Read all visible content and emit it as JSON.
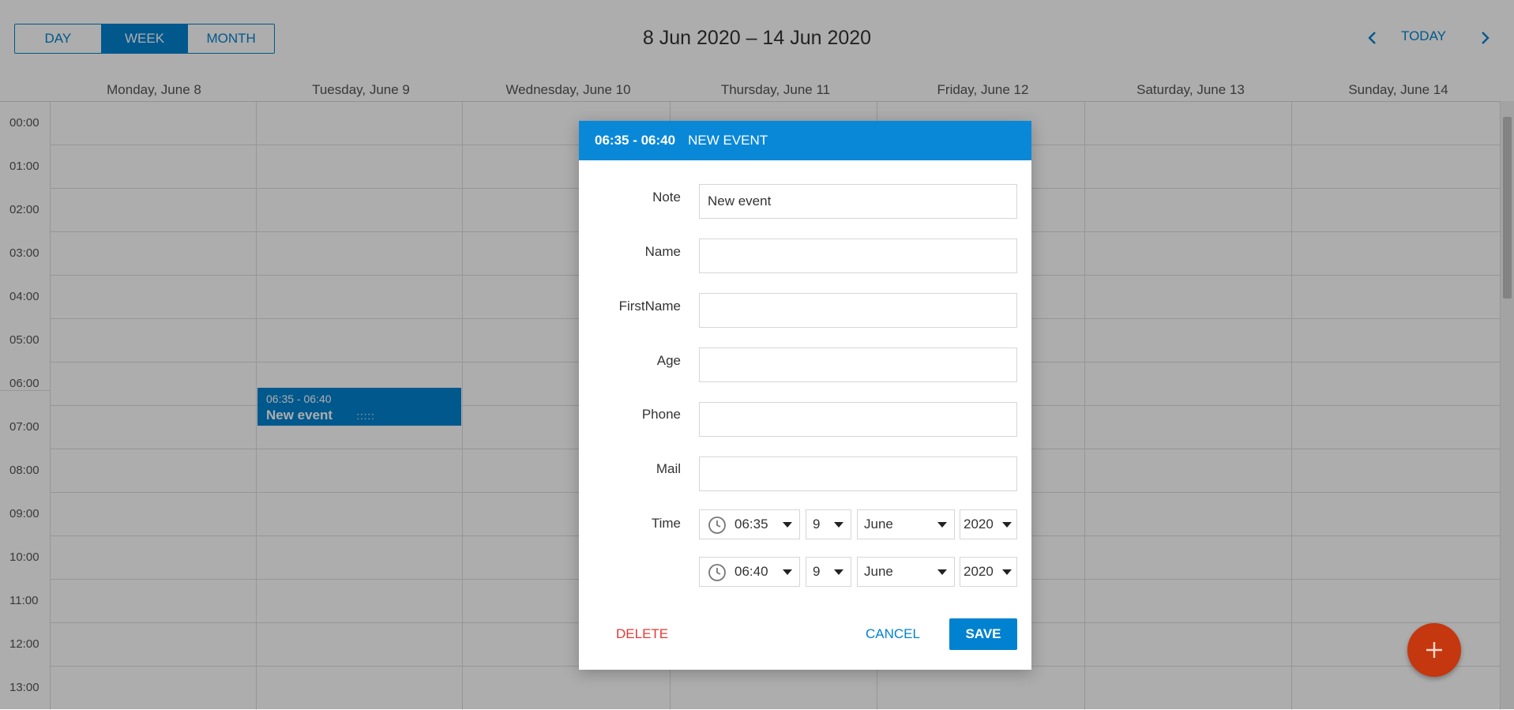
{
  "toolbar": {
    "views": [
      {
        "label": "DAY",
        "active": false
      },
      {
        "label": "WEEK",
        "active": true
      },
      {
        "label": "MONTH",
        "active": false
      }
    ],
    "range_title": "8 Jun 2020 – 14 Jun 2020",
    "today_label": "TODAY",
    "prev_icon": "chevron-left-icon",
    "next_icon": "chevron-right-icon"
  },
  "days": [
    "Monday, June 8",
    "Tuesday, June 9",
    "Wednesday, June 10",
    "Thursday, June 11",
    "Friday, June 12",
    "Saturday, June 13",
    "Sunday, June 14"
  ],
  "hours": [
    "00:00",
    "01:00",
    "02:00",
    "03:00",
    "04:00",
    "05:00",
    "06:00",
    "07:00",
    "08:00",
    "09:00",
    "10:00",
    "11:00",
    "12:00",
    "13:00"
  ],
  "event": {
    "time": "06:35 - 06:40",
    "title": "New event",
    "handle": ":::::"
  },
  "dialog": {
    "header_time": "06:35 - 06:40",
    "header_title": "NEW EVENT",
    "fields": [
      {
        "label": "Note",
        "value": "New event"
      },
      {
        "label": "Name",
        "value": ""
      },
      {
        "label": "FirstName",
        "value": ""
      },
      {
        "label": "Age",
        "value": ""
      },
      {
        "label": "Phone",
        "value": ""
      },
      {
        "label": "Mail",
        "value": ""
      }
    ],
    "time_label": "Time",
    "start": {
      "time": "06:35",
      "day": "9",
      "month": "June",
      "year": "2020"
    },
    "end": {
      "time": "06:40",
      "day": "9",
      "month": "June",
      "year": "2020"
    },
    "delete_label": "DELETE",
    "cancel_label": "CANCEL",
    "save_label": "SAVE"
  },
  "colors": {
    "accent": "#0182d0",
    "header": "#0a88d8",
    "delete": "#e53935",
    "fab": "#c4370f"
  },
  "fab_icon": "plus-icon"
}
